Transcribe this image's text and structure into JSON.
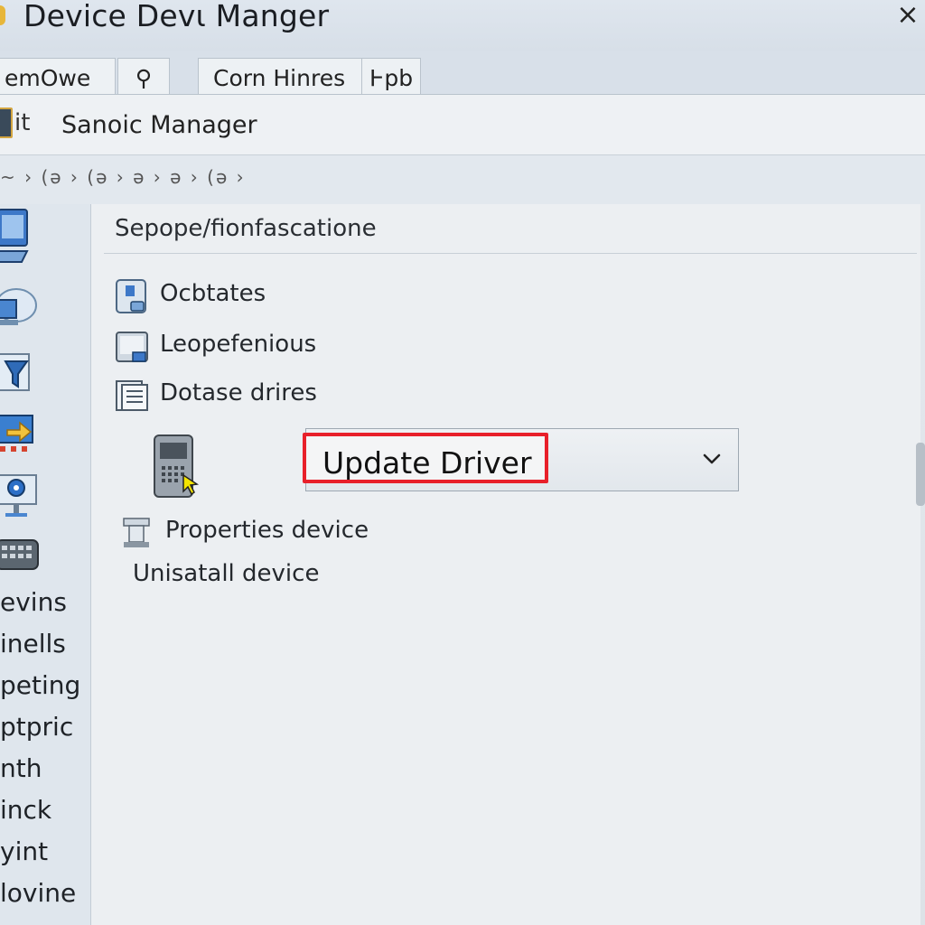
{
  "window": {
    "title": "Device Devι Manger",
    "close_glyph": "×"
  },
  "tabs": [
    {
      "label": "emOwe"
    },
    {
      "label": "⚲"
    },
    {
      "label": "Corn Hinres"
    },
    {
      "label": "Ͱpb"
    }
  ],
  "header": {
    "prefix": "it",
    "title": "Sanoic Manager"
  },
  "breadcrumb": {
    "text": "~ › (ə › (ə › ə › ə › (ə ›"
  },
  "sidebar": {
    "icons": [
      "monitor-icon",
      "cloud-network-icon",
      "funnel-folder-icon",
      "arrow-folder-icon",
      "webcam-icon",
      "keyboard-icon"
    ],
    "labels": [
      "evins",
      "inells",
      "peting",
      "ptpric",
      "nth",
      "inck",
      "yint",
      "lovine"
    ]
  },
  "panel": {
    "heading": "Sepope/fionfascatione",
    "items": [
      {
        "label": "Ocbtates",
        "icon": "device-small-icon"
      },
      {
        "label": "Leopefenious",
        "icon": "window-icon"
      },
      {
        "label": "Dotase drires",
        "icon": "document-list-icon"
      }
    ],
    "dropdown": {
      "selected": "Update Driver",
      "chevron": "chevron-down-icon"
    },
    "properties_label": "Properties device",
    "uninstall_label": "Unisatall device"
  },
  "colors": {
    "highlight": "#e8202a",
    "accent": "#2b6fc2"
  }
}
